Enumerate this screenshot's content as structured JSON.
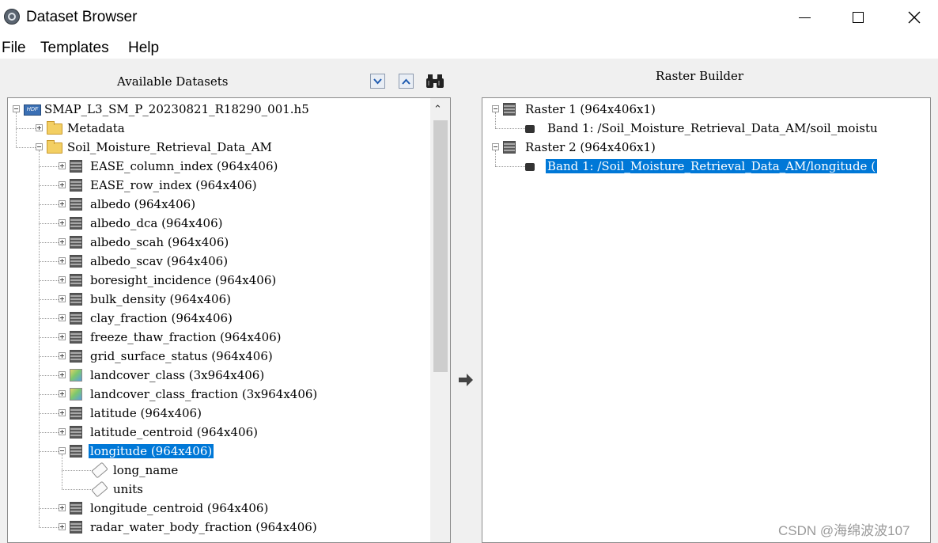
{
  "window": {
    "title": "Dataset Browser"
  },
  "menu": [
    "File",
    "Templates",
    "Help"
  ],
  "left_panel": {
    "title": "Available Datasets",
    "buttons": [
      {
        "name": "expand-all-button",
        "icon": "chevron-down-icon"
      },
      {
        "name": "collapse-all-button",
        "icon": "chevron-up-icon"
      },
      {
        "name": "search-button",
        "icon": "binoculars-icon"
      }
    ],
    "tree": [
      {
        "label": "SMAP_L3_SM_P_20230821_R18290_001.h5",
        "icon": "hdf-file-icon",
        "expander": "minus",
        "level": 0
      },
      {
        "label": "Metadata",
        "icon": "folder-icon",
        "expander": "plus",
        "level": 1
      },
      {
        "label": "Soil_Moisture_Retrieval_Data_AM",
        "icon": "folder-icon",
        "expander": "minus",
        "level": 1
      },
      {
        "label": "EASE_column_index (964x406)",
        "icon": "raster-icon",
        "expander": "plus",
        "level": 2
      },
      {
        "label": "EASE_row_index (964x406)",
        "icon": "raster-icon",
        "expander": "plus",
        "level": 2
      },
      {
        "label": "albedo (964x406)",
        "icon": "raster-icon",
        "expander": "plus",
        "level": 2
      },
      {
        "label": "albedo_dca (964x406)",
        "icon": "raster-icon",
        "expander": "plus",
        "level": 2
      },
      {
        "label": "albedo_scah (964x406)",
        "icon": "raster-icon",
        "expander": "plus",
        "level": 2
      },
      {
        "label": "albedo_scav (964x406)",
        "icon": "raster-icon",
        "expander": "plus",
        "level": 2
      },
      {
        "label": "boresight_incidence (964x406)",
        "icon": "raster-icon",
        "expander": "plus",
        "level": 2
      },
      {
        "label": "bulk_density (964x406)",
        "icon": "raster-icon",
        "expander": "plus",
        "level": 2
      },
      {
        "label": "clay_fraction (964x406)",
        "icon": "raster-icon",
        "expander": "plus",
        "level": 2
      },
      {
        "label": "freeze_thaw_fraction (964x406)",
        "icon": "raster-icon",
        "expander": "plus",
        "level": 2
      },
      {
        "label": "grid_surface_status (964x406)",
        "icon": "raster-icon",
        "expander": "plus",
        "level": 2
      },
      {
        "label": "landcover_class (3x964x406)",
        "icon": "class-raster-icon",
        "expander": "plus",
        "level": 2
      },
      {
        "label": "landcover_class_fraction (3x964x406)",
        "icon": "class-raster-icon",
        "expander": "plus",
        "level": 2
      },
      {
        "label": "latitude (964x406)",
        "icon": "raster-icon",
        "expander": "plus",
        "level": 2
      },
      {
        "label": "latitude_centroid (964x406)",
        "icon": "raster-icon",
        "expander": "plus",
        "level": 2
      },
      {
        "label": "longitude (964x406)",
        "icon": "raster-icon",
        "expander": "minus",
        "level": 2,
        "selected": true
      },
      {
        "label": "long_name",
        "icon": "attribute-tag-icon",
        "expander": "none",
        "level": 3
      },
      {
        "label": "units",
        "icon": "attribute-tag-icon",
        "expander": "none",
        "level": 3
      },
      {
        "label": "longitude_centroid (964x406)",
        "icon": "raster-icon",
        "expander": "plus",
        "level": 2
      },
      {
        "label": "radar_water_body_fraction (964x406)",
        "icon": "raster-icon",
        "expander": "plus",
        "level": 2
      }
    ]
  },
  "transfer_button": {
    "icon": "arrow-right-icon"
  },
  "right_panel": {
    "title": "Raster Builder",
    "tree": [
      {
        "label": "Raster 1 (964x406x1)",
        "icon": "raster-icon",
        "expander": "minus",
        "level": 0
      },
      {
        "label": "Band 1: /Soil_Moisture_Retrieval_Data_AM/soil_moistu",
        "icon": "band-icon",
        "expander": "none",
        "level": 1
      },
      {
        "label": "Raster 2 (964x406x1)",
        "icon": "raster-icon",
        "expander": "minus",
        "level": 0
      },
      {
        "label": "Band 1: /Soil_Moisture_Retrieval_Data_AM/longitude (",
        "icon": "band-icon",
        "expander": "none",
        "level": 1,
        "selected": true
      }
    ]
  },
  "watermark": "CSDN @海绵波波107",
  "colors": {
    "selection": "#0078d7",
    "folder": "#f3cf63"
  }
}
